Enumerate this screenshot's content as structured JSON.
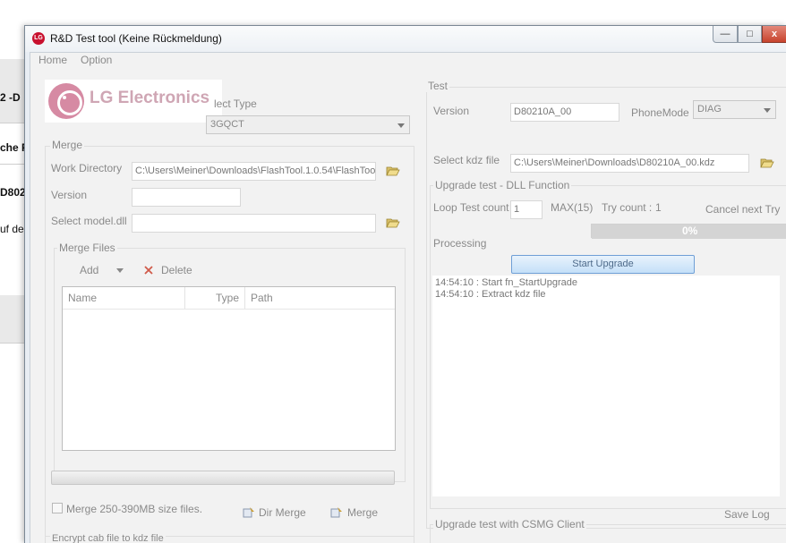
{
  "background_app": {
    "rows": [
      "2 -D",
      "che F",
      "D802",
      "uf der"
    ]
  },
  "window": {
    "title": "R&D Test tool (Keine Rückmeldung)",
    "icon_text": "LG",
    "min_glyph": "—",
    "max_glyph": "□",
    "close_glyph": "x"
  },
  "menu": [
    "Home",
    "Option"
  ],
  "logo": {
    "text": "LG Electronics"
  },
  "left": {
    "select_type_label": "lect Type",
    "select_type_value": "3GQCT",
    "merge_group": "Merge",
    "work_dir_label": "Work Directory",
    "work_dir_value": "C:\\Users\\Meiner\\Downloads\\FlashTool.1.0.54\\FlashToo",
    "version_label": "Version",
    "version_value": "",
    "model_dll_label": "Select model.dll",
    "model_dll_value": "",
    "merge_files_group": "Merge Files",
    "add_label": "Add",
    "delete_label": "Delete",
    "columns": [
      "Name",
      "Type",
      "Path"
    ],
    "merge_size_label": "Merge 250-390MB size files.",
    "dir_merge_label": "Dir Merge",
    "merge_label": "Merge",
    "encrypt_group": "Encrypt cab file to kdz file"
  },
  "right": {
    "test_group": "Test",
    "version_label": "Version",
    "version_value": "D80210A_00",
    "phone_mode_label": "PhoneMode",
    "phone_mode_value": "DIAG",
    "kdz_label": "Select kdz file",
    "kdz_value": "C:\\Users\\Meiner\\Downloads\\D80210A_00.kdz",
    "upgrade_group": "Upgrade test - DLL Function",
    "loop_label": "Loop Test count",
    "loop_value": "1",
    "max_label": "MAX(15)",
    "try_count_label": "Try count :",
    "try_count_value": "1",
    "cancel_next_label": "Cancel next Try",
    "progress_percent": 0,
    "progress_text": "0%",
    "processing_label": "Processing",
    "start_upgrade_label": "Start Upgrade",
    "log_lines": [
      "14:54:10 : Start fn_StartUpgrade",
      "14:54:10 : Extract kdz file"
    ],
    "save_log_label": "Save Log",
    "csmg_group": "Upgrade test with CSMG Client"
  }
}
